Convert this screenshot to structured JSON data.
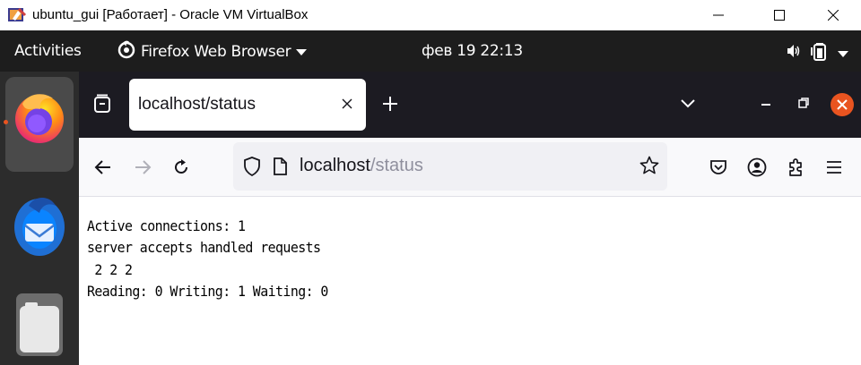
{
  "window": {
    "title": "ubuntu_gui [Работает] - Oracle VM VirtualBox"
  },
  "gnome": {
    "activities_label": "Activities",
    "app_menu_label": "Firefox Web Browser",
    "clock": "фев 19  22:13"
  },
  "dock": {
    "items": [
      "firefox-icon",
      "thunderbird-icon",
      "files-icon"
    ]
  },
  "browser": {
    "tab_title": "localhost/status",
    "url_host": "localhost",
    "url_path": "/status"
  },
  "page": {
    "lines": [
      "Active connections: 1",
      "server accepts handled requests",
      " 2 2 2",
      "Reading: 0 Writing: 1 Waiting: 0"
    ]
  },
  "colors": {
    "ubuntu_orange": "#e95420",
    "gnome_bar": "#1d1d1d",
    "dock": "#2c2c2c",
    "tabstrip": "#1c1b22",
    "navbar": "#f9f9fb"
  }
}
